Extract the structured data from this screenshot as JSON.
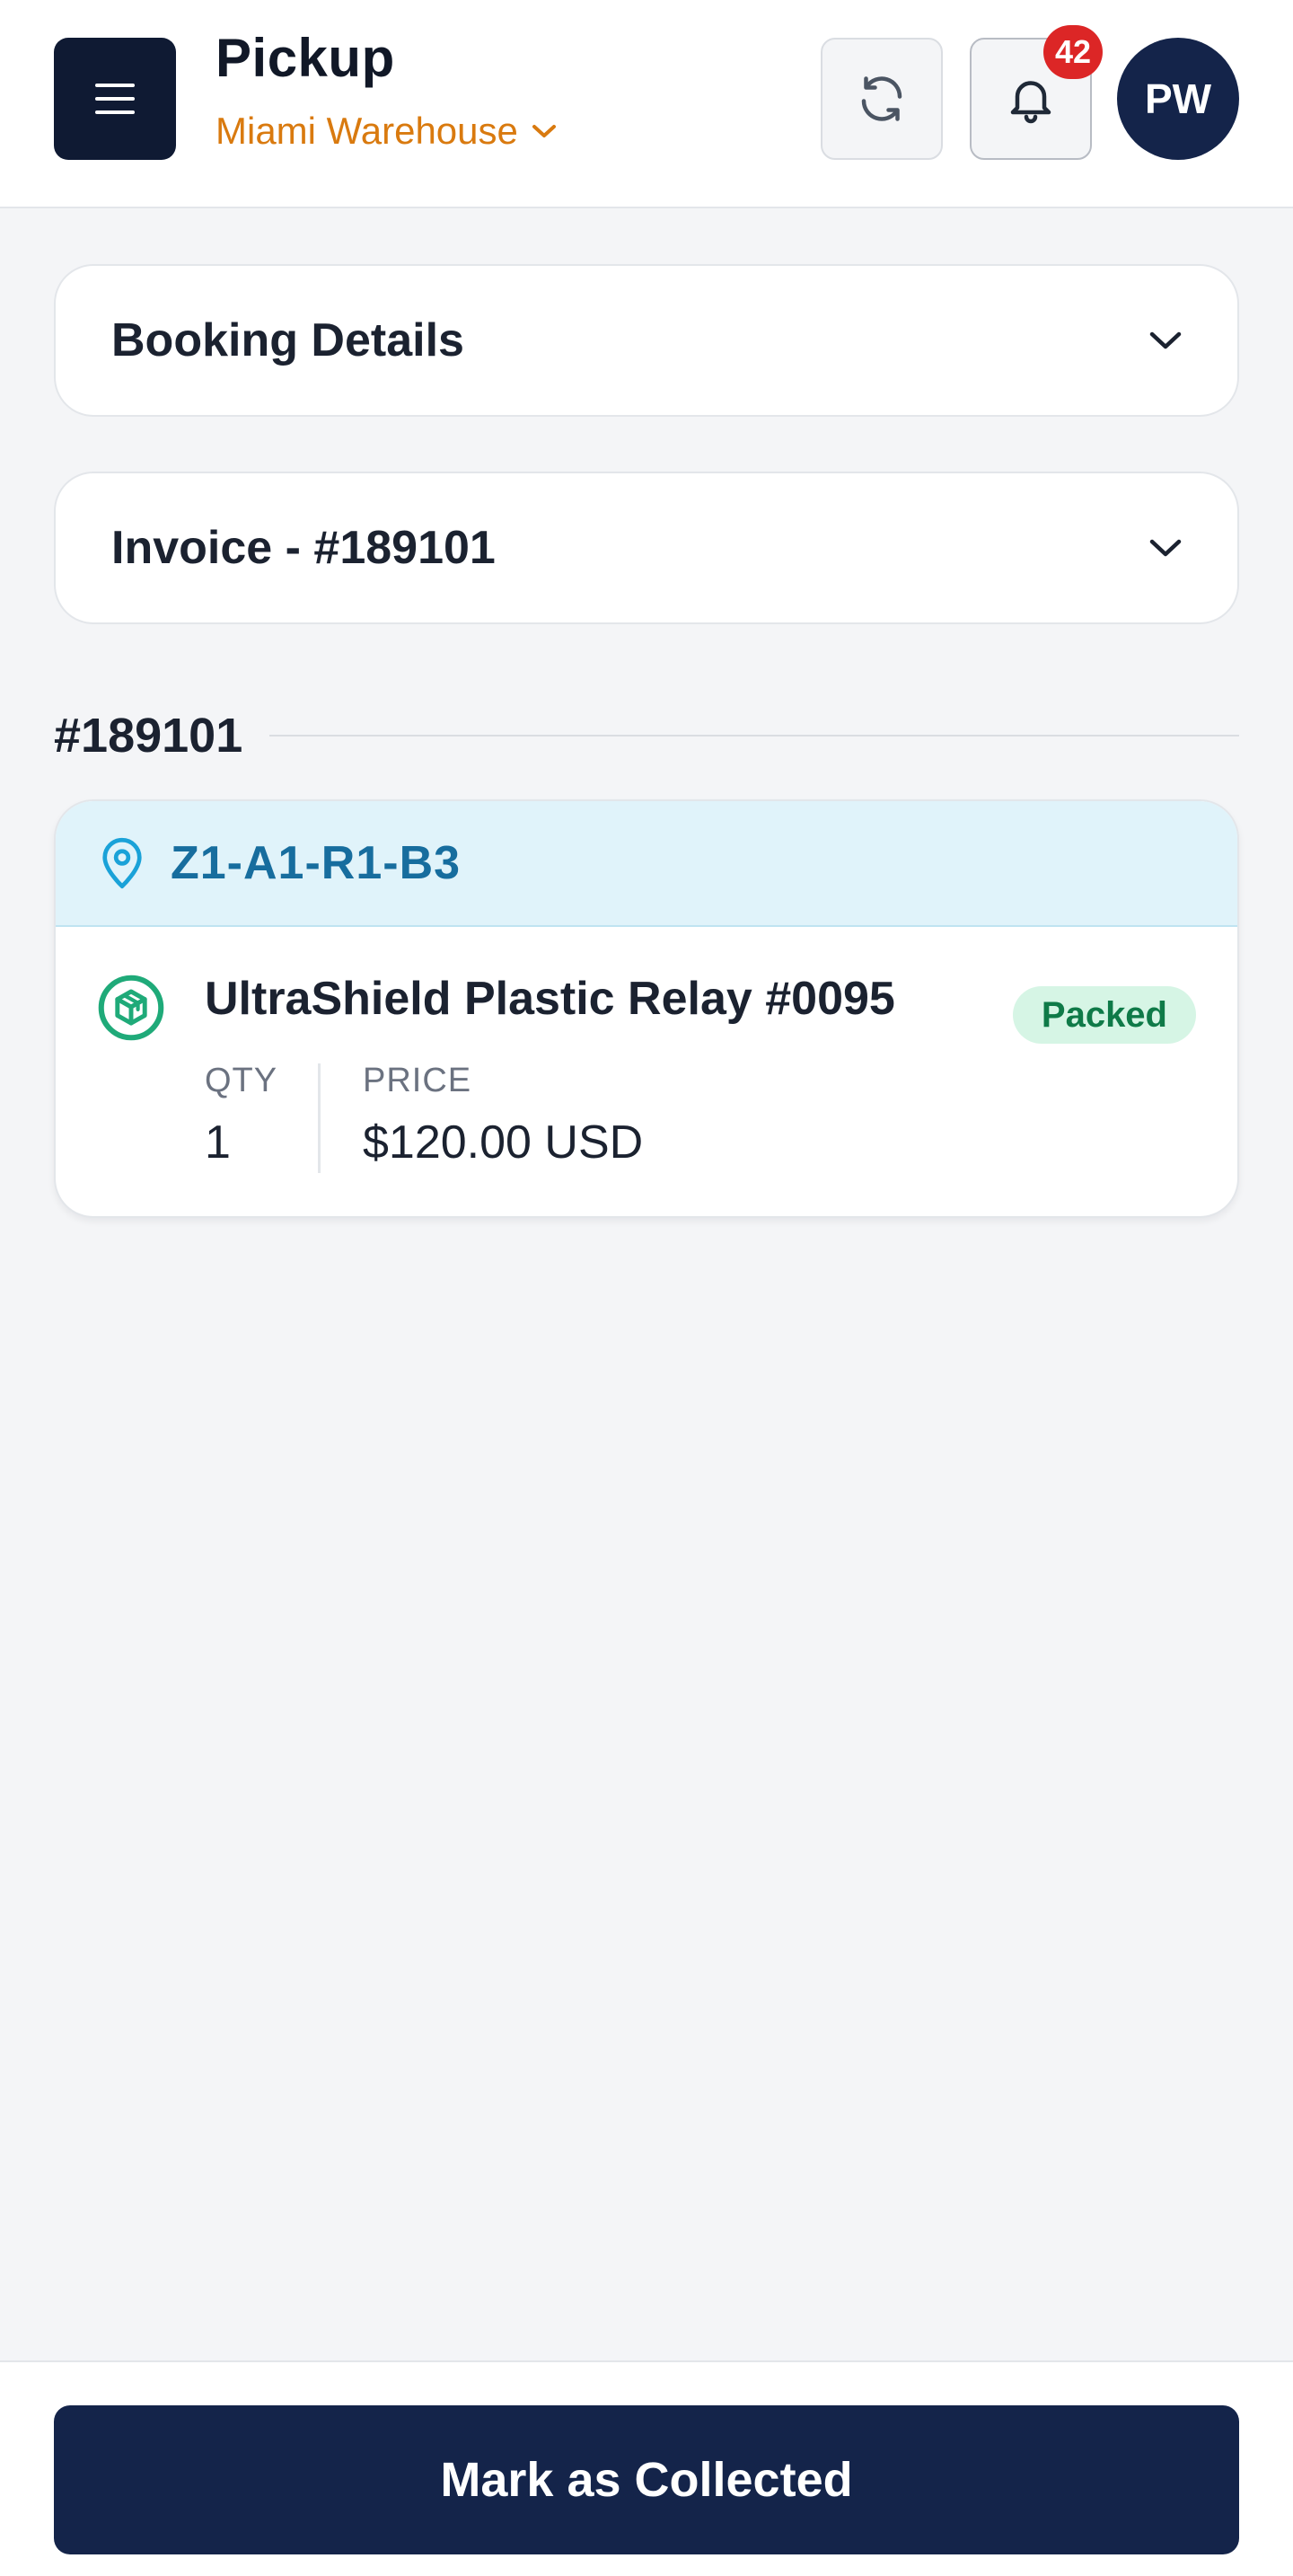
{
  "header": {
    "title": "Pickup",
    "location": "Miami Warehouse",
    "notification_count": "42",
    "avatar_initials": "PW",
    "icons": {
      "menu": "hamburger-menu-icon",
      "location_dropdown": "chevron-down-icon",
      "refresh": "refresh-icon",
      "notifications": "bell-icon"
    }
  },
  "accordions": [
    {
      "label": "Booking Details",
      "icon": "chevron-down-icon"
    },
    {
      "label": "Invoice - #189101",
      "icon": "chevron-down-icon"
    }
  ],
  "section": {
    "invoice_number": "#189101"
  },
  "item_card": {
    "location_code": "Z1-A1-R1-B3",
    "location_icon": "map-pin-icon",
    "item_icon": "package-icon",
    "name": "UltraShield Plastic Relay #0095",
    "status": "Packed",
    "qty_label": "QTY",
    "qty_value": "1",
    "price_label": "PRICE",
    "price_value": "$120.00 USD"
  },
  "footer": {
    "primary_action": "Mark as Collected"
  },
  "colors": {
    "primary": "#14244A",
    "accent_orange": "#D97A0F",
    "badge_red": "#DC2626",
    "location_blue": "#176D9E",
    "status_green": "#0F7A48",
    "status_green_bg": "#D6F5E5"
  }
}
